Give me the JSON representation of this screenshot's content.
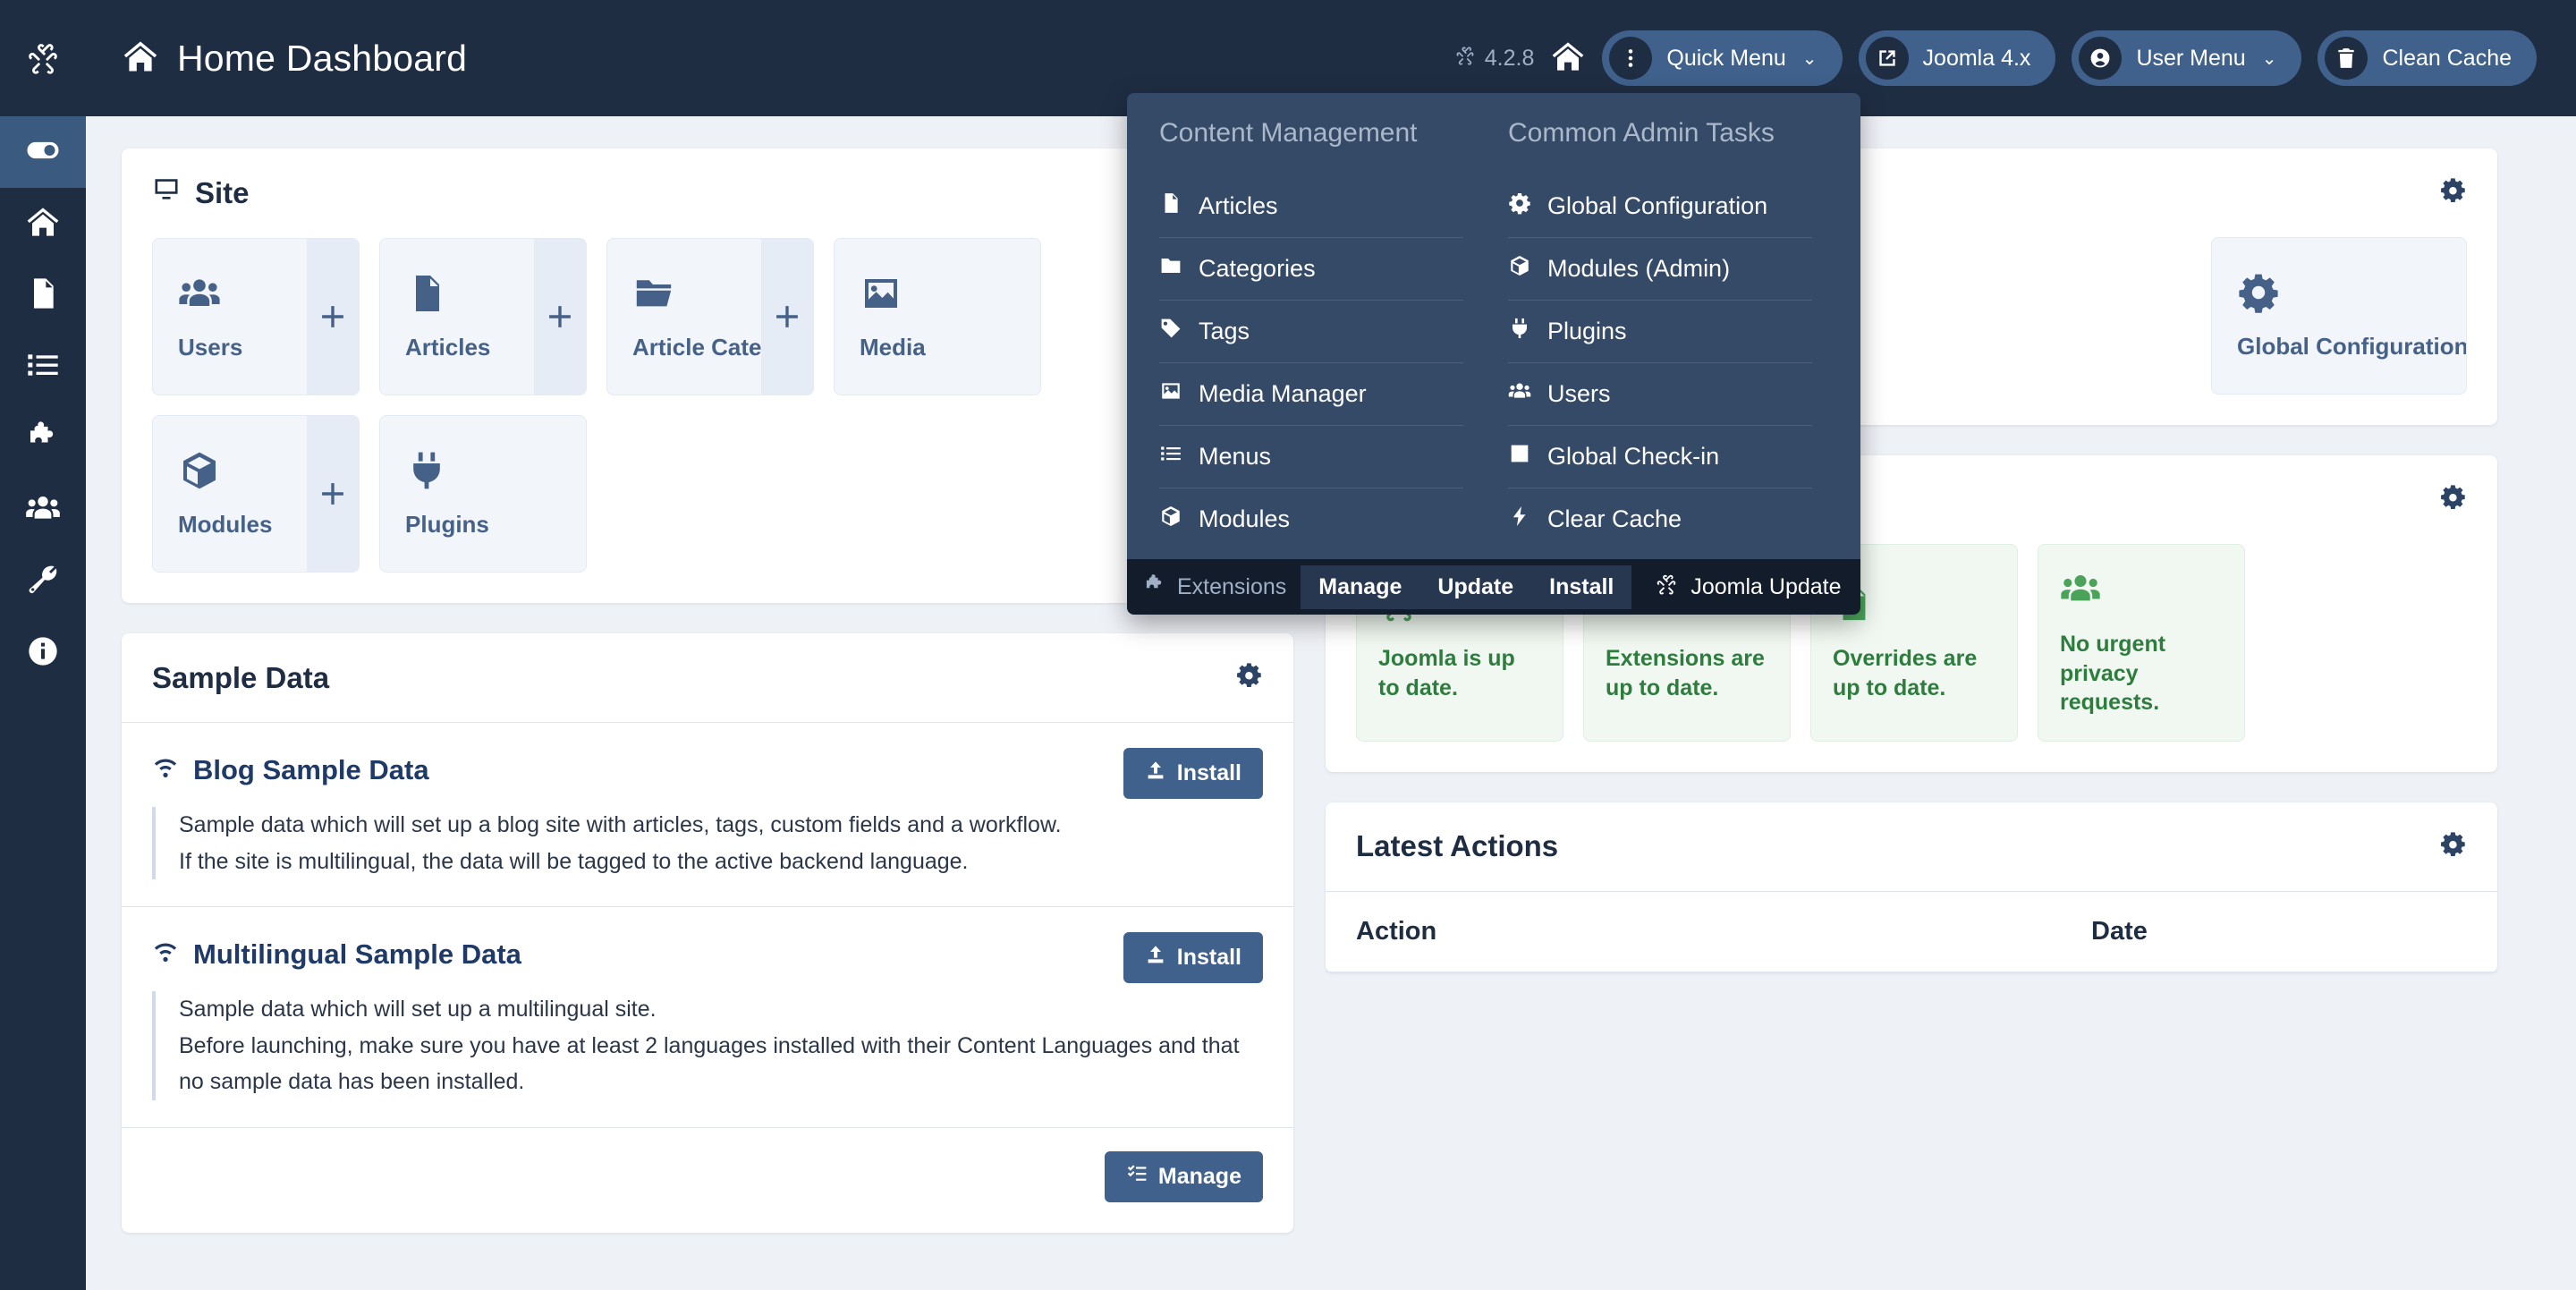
{
  "app": {
    "title": "Home Dashboard",
    "version": "4.2.8"
  },
  "sidebar": {
    "items": [
      {
        "name": "toggle-menu",
        "icon": "toggle-icon"
      },
      {
        "name": "home",
        "icon": "home-icon"
      },
      {
        "name": "content",
        "icon": "document-icon"
      },
      {
        "name": "menus",
        "icon": "list-icon"
      },
      {
        "name": "components",
        "icon": "puzzle-icon"
      },
      {
        "name": "users",
        "icon": "users-icon"
      },
      {
        "name": "system",
        "icon": "wrench-icon"
      },
      {
        "name": "help",
        "icon": "info-icon"
      }
    ]
  },
  "header": {
    "version_label": "4.2.8",
    "buttons": [
      {
        "label": "Quick Menu",
        "icon": "kebab-icon",
        "caret": "⌄"
      },
      {
        "label": "Joomla 4.x",
        "icon": "external-link-icon",
        "caret": ""
      },
      {
        "label": "User Menu",
        "icon": "user-circle-icon",
        "caret": "⌄"
      },
      {
        "label": "Clean Cache",
        "icon": "trash-icon",
        "caret": ""
      }
    ]
  },
  "quick_menu": {
    "columns": [
      {
        "heading": "Content Management",
        "items": [
          {
            "label": "Articles",
            "icon": "document-icon"
          },
          {
            "label": "Categories",
            "icon": "folder-icon"
          },
          {
            "label": "Tags",
            "icon": "tag-icon"
          },
          {
            "label": "Media Manager",
            "icon": "image-icon"
          },
          {
            "label": "Menus",
            "icon": "list-icon"
          },
          {
            "label": "Modules",
            "icon": "cube-icon"
          }
        ]
      },
      {
        "heading": "Common Admin Tasks",
        "items": [
          {
            "label": "Global Configuration",
            "icon": "gear-icon"
          },
          {
            "label": "Modules (Admin)",
            "icon": "cube-icon"
          },
          {
            "label": "Plugins",
            "icon": "plug-icon"
          },
          {
            "label": "Users",
            "icon": "users-icon"
          },
          {
            "label": "Global Check-in",
            "icon": "checkbox-icon"
          },
          {
            "label": "Clear Cache",
            "icon": "bolt-icon"
          }
        ]
      }
    ],
    "footer": {
      "extensions_label": "Extensions",
      "buttons": [
        "Manage",
        "Update",
        "Install"
      ],
      "joomla_update_label": "Joomla Update"
    }
  },
  "site_panel": {
    "title": "Site",
    "tiles": [
      {
        "label": "Users",
        "icon": "users-icon",
        "has_plus": true
      },
      {
        "label": "Articles",
        "icon": "document-icon",
        "has_plus": true
      },
      {
        "label": "Article Categories",
        "icon": "folder-icon",
        "has_plus": true
      },
      {
        "label": "Media",
        "icon": "image-icon",
        "has_plus": false
      },
      {
        "label": "Modules",
        "icon": "cube-icon",
        "has_plus": true
      },
      {
        "label": "Plugins",
        "icon": "plug-icon",
        "has_plus": false
      }
    ]
  },
  "system_panel": {
    "tiles": [
      {
        "label": "Global Configuration",
        "icon": "gear-icon",
        "has_plus": false
      }
    ]
  },
  "sample_data": {
    "title": "Sample Data",
    "items": [
      {
        "title": "Blog Sample Data",
        "icon": "wifi-icon",
        "description": "Sample data which will set up a blog site with articles, tags, custom fields and a workflow.\nIf the site is multilingual, the data will be tagged to the active backend language.",
        "button_label": "Install"
      },
      {
        "title": "Multilingual Sample Data",
        "icon": "wifi-icon",
        "description": "Sample data which will set up a multilingual site.\nBefore launching, make sure you have at least 2 languages installed with their Content Languages and that no sample data has been installed.",
        "button_label": "Install"
      }
    ],
    "manage_label": "Manage"
  },
  "status_panel": {
    "tiles": [
      {
        "label": "Joomla is up to date.",
        "icon": "joomla-icon"
      },
      {
        "label": "Extensions are up to date.",
        "icon": "puzzle-icon"
      },
      {
        "label": "Overrides are up to date.",
        "icon": "file-icon"
      },
      {
        "label": "No urgent privacy requests.",
        "icon": "users-icon"
      }
    ]
  },
  "latest_actions": {
    "title": "Latest Actions",
    "columns": [
      "Action",
      "Date"
    ],
    "rows": []
  },
  "colors": {
    "header_bg": "#1f2d43",
    "dropdown_bg": "#344a67",
    "dropdown_footer_bg": "#121c2b",
    "accent": "#3f618c",
    "tile_text": "#466188",
    "status_green": "#2e7d3e",
    "page_bg": "#eef1f6"
  }
}
